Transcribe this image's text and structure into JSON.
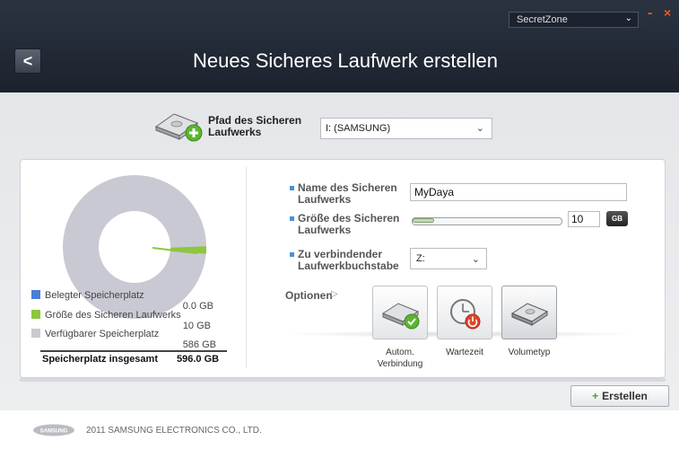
{
  "window": {
    "zone_selector": "SecretZone",
    "minimize": "-",
    "close": "×"
  },
  "header": {
    "title": "Neues Sicheres Laufwerk erstellen",
    "back": "<"
  },
  "path": {
    "label_line1": "Pfad des Sicheren",
    "label_line2": "Laufwerks",
    "selected": "I: (SAMSUNG)"
  },
  "usage": {
    "legend": [
      {
        "label": "Belegter Speicherplatz",
        "value": "0.0 GB",
        "color": "#4a7fd6"
      },
      {
        "label": "Größe des Sicheren Laufwerks",
        "value": "10 GB",
        "color": "#8dc63f"
      },
      {
        "label": "Verfügbarer Speicherplatz",
        "value": "586 GB",
        "color": "#c9c9d0"
      }
    ],
    "total_label": "Speicherplatz insgesamt",
    "total_value": "596.0 GB"
  },
  "form": {
    "name_label_1": "Name des Sicheren",
    "name_label_2": "Laufwerks",
    "name_value": "MyDaya",
    "size_label_1": "Größe des Sicheren",
    "size_label_2": "Laufwerks",
    "size_value": "10",
    "size_unit": "GB",
    "size_fraction": 0.017,
    "drive_label_1": "Zu verbindender",
    "drive_label_2": "Laufwerkbuchstabe",
    "drive_value": "Z:"
  },
  "options": {
    "label": "Optionen",
    "items": [
      {
        "label_1": "Autom.",
        "label_2": "Verbindung",
        "icon": "drive-check-icon"
      },
      {
        "label_1": "Wartezeit",
        "label_2": "",
        "icon": "clock-power-icon"
      },
      {
        "label_1": "Volumetyp",
        "label_2": "",
        "icon": "drive-icon"
      }
    ],
    "selected_index": 2
  },
  "actions": {
    "create": "Erstellen"
  },
  "footer": {
    "brand": "SAMSUNG",
    "copyright": "2011 SAMSUNG ELECTRONICS CO., LTD."
  }
}
